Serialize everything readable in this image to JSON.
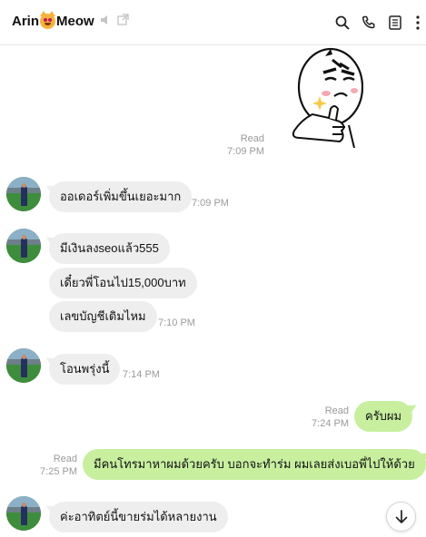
{
  "header": {
    "title_left": "Arin",
    "title_right": "Meow",
    "icons": [
      "cat-emoji-icon",
      "speaker-muted-icon",
      "open-external-icon",
      "search-icon",
      "phone-icon",
      "notes-icon",
      "more-icon"
    ]
  },
  "messages": {
    "sticker": {
      "read": "Read",
      "time": "7:09 PM"
    },
    "m1": {
      "text": "ออเดอร์เพิ่มขึ้นเยอะมาก",
      "time": "7:09 PM"
    },
    "m2": {
      "text": "มีเงินลงseoแล้ว555"
    },
    "m3": {
      "text": "เดี๋ยวพี่โอนไป15,000บาท"
    },
    "m4": {
      "text": "เลขบัญชีเดิมไหม",
      "time": "7:10 PM"
    },
    "m5": {
      "text": "โอนพรุ่งนี้",
      "time": "7:14 PM"
    },
    "m6": {
      "text": "ครับผม",
      "read": "Read",
      "time": "7:24 PM"
    },
    "m7": {
      "text": "มีคนโทรมาหาผมด้วยครับ บอกจะทำร่ม ผมเลยส่งเบอพี่ไปให้ด้วย",
      "read": "Read",
      "time": "7:25 PM"
    },
    "m8": {
      "text": "ค่ะอาทิตย์นี้ขายร่มได้หลายงาน"
    }
  },
  "colors": {
    "incoming": "#eeeeee",
    "outgoing": "#c7ef9e",
    "meta": "#9a9a9a"
  }
}
